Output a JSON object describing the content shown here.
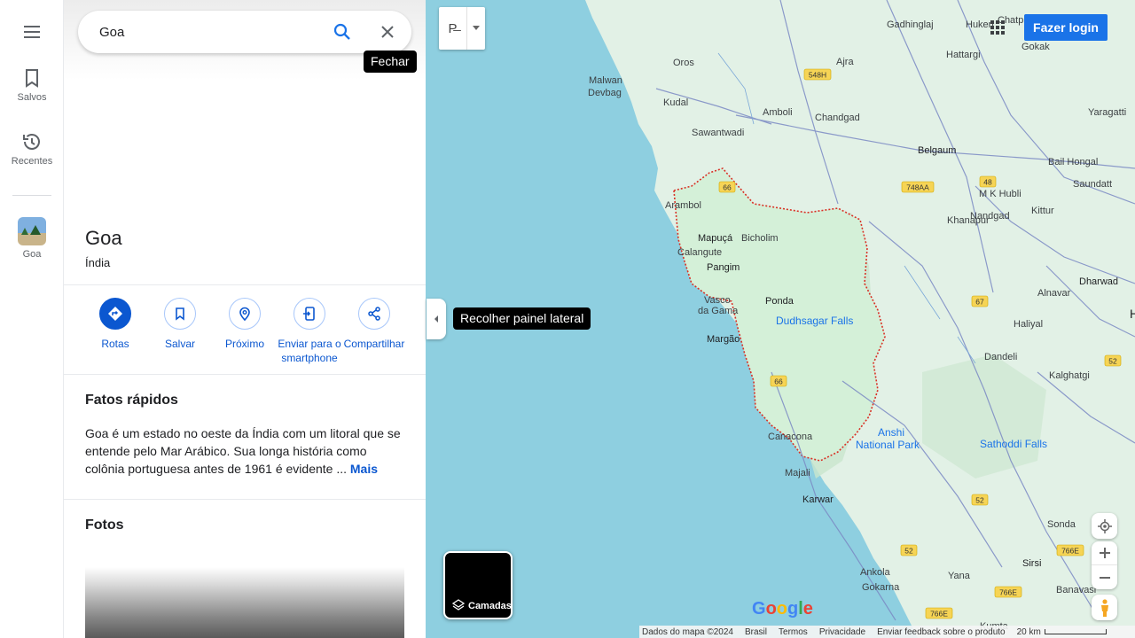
{
  "rail": {
    "saved_label": "Salvos",
    "recent_label": "Recentes",
    "recent_place_label": "Goa"
  },
  "search": {
    "value": "Goa",
    "close_tooltip": "Fechar"
  },
  "place": {
    "title": "Goa",
    "subtitle": "Índia"
  },
  "actions": [
    {
      "label": "Rotas",
      "icon": "directions-icon"
    },
    {
      "label": "Salvar",
      "icon": "bookmark-icon"
    },
    {
      "label": "Próximo",
      "icon": "nearby-icon"
    },
    {
      "label": "Enviar para o smartphone",
      "icon": "send-to-phone-icon"
    },
    {
      "label": "Compartilhar",
      "icon": "share-icon"
    }
  ],
  "quick_facts": {
    "heading": "Fatos rápidos",
    "text": "Goa é um estado no oeste da Índia com um litoral que se entende pelo Mar Arábico. Sua longa história como colônia portuguesa antes de 1961 é evidente ...",
    "more_label": "Mais"
  },
  "photos": {
    "heading": "Fotos"
  },
  "map": {
    "collapse_tooltip": "Recolher painel lateral",
    "map_type_label": "P̶",
    "login_label": "Fazer login",
    "layers_label": "Camadas",
    "google_logo": "Google",
    "footer": {
      "data": "Dados do mapa ©2024",
      "country": "Brasil",
      "terms": "Termos",
      "privacy": "Privacidade",
      "feedback": "Enviar feedback sobre o produto",
      "scale": "20 km"
    },
    "places": [
      "Gadhinglaj",
      "Hukeri",
      "Chatp",
      "Gokak",
      "Oros",
      "Ajra",
      "Hattargi",
      "Malwan",
      "Devbag",
      "Kudal",
      "Amboli",
      "Chandgad",
      "Yaragatti",
      "Sawantwadi",
      "Belgaum",
      "Bail Hongal",
      "Saundatt",
      "M K Hubli",
      "Arambol",
      "Khanapur",
      "Nandgad",
      "Kittur",
      "Mapuçá",
      "Bicholim",
      "Calangute",
      "Pangim",
      "Dharwad",
      "Ponda",
      "Alnavar",
      "Vasco",
      "da Gama",
      "Dudhsagar Falls",
      "Haliyal",
      "Margão",
      "Dandeli",
      "Kalghatgi",
      "Anshi",
      "National Park",
      "Sathoddi Falls",
      "Canacona",
      "Majali",
      "Karwar",
      "Sonda",
      "Sirsi",
      "Ankola",
      "Yana",
      "Gokarna",
      "Banavasi",
      "Kumta",
      "H"
    ],
    "road_shields": [
      "548H",
      "66",
      "48",
      "748AA",
      "67",
      "52",
      "66",
      "52",
      "766E",
      "52",
      "766E",
      "766E"
    ],
    "colors": {
      "water": "#8ecfe0",
      "land": "#dff2e4",
      "goa_border": "#d93025",
      "roads": "#7b8ac4"
    }
  }
}
